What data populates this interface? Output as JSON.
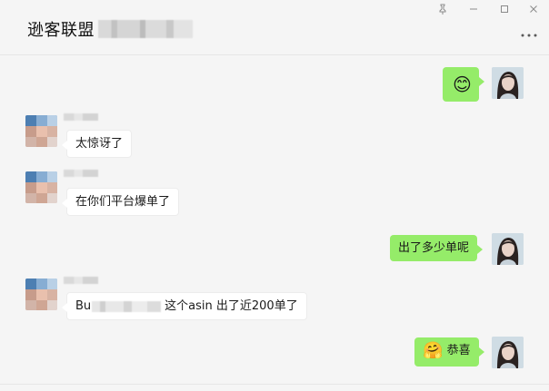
{
  "header": {
    "title": "逊客联盟"
  },
  "window_controls": {
    "pin": "pin-icon",
    "minimize": "minimize-icon",
    "maximize": "maximize-icon",
    "close": "close-icon",
    "more": "more-options-icon"
  },
  "messages": [
    {
      "side": "right",
      "type": "emoji",
      "emoji": "😊"
    },
    {
      "side": "left",
      "text": "太惊讶了"
    },
    {
      "side": "left",
      "text": "在你们平台爆单了"
    },
    {
      "side": "right",
      "text": "出了多少单呢"
    },
    {
      "side": "left",
      "text_prefix": "Bu",
      "text_suffix": "这个asin  出了近200单了"
    },
    {
      "side": "right",
      "emoji": "🤗",
      "text": "恭喜"
    }
  ],
  "colors": {
    "self_bubble": "#95ec69",
    "other_bubble": "#ffffff",
    "background": "#f5f5f5"
  }
}
